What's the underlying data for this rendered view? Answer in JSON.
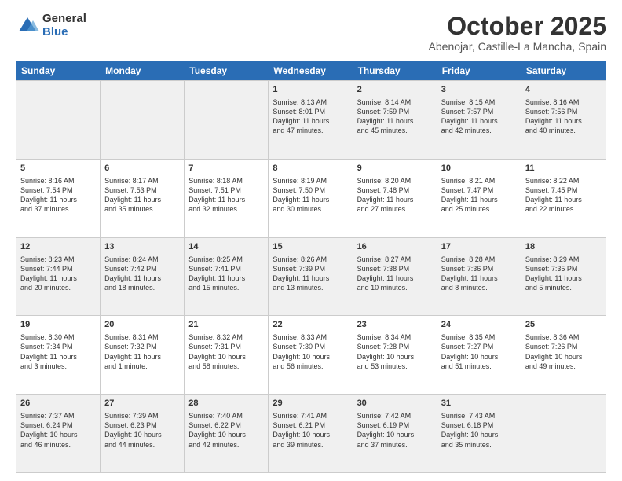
{
  "logo": {
    "general": "General",
    "blue": "Blue"
  },
  "header": {
    "month": "October 2025",
    "location": "Abenojar, Castille-La Mancha, Spain"
  },
  "days": [
    "Sunday",
    "Monday",
    "Tuesday",
    "Wednesday",
    "Thursday",
    "Friday",
    "Saturday"
  ],
  "rows": [
    [
      {
        "num": "",
        "text": ""
      },
      {
        "num": "",
        "text": ""
      },
      {
        "num": "",
        "text": ""
      },
      {
        "num": "1",
        "text": "Sunrise: 8:13 AM\nSunset: 8:01 PM\nDaylight: 11 hours\nand 47 minutes."
      },
      {
        "num": "2",
        "text": "Sunrise: 8:14 AM\nSunset: 7:59 PM\nDaylight: 11 hours\nand 45 minutes."
      },
      {
        "num": "3",
        "text": "Sunrise: 8:15 AM\nSunset: 7:57 PM\nDaylight: 11 hours\nand 42 minutes."
      },
      {
        "num": "4",
        "text": "Sunrise: 8:16 AM\nSunset: 7:56 PM\nDaylight: 11 hours\nand 40 minutes."
      }
    ],
    [
      {
        "num": "5",
        "text": "Sunrise: 8:16 AM\nSunset: 7:54 PM\nDaylight: 11 hours\nand 37 minutes."
      },
      {
        "num": "6",
        "text": "Sunrise: 8:17 AM\nSunset: 7:53 PM\nDaylight: 11 hours\nand 35 minutes."
      },
      {
        "num": "7",
        "text": "Sunrise: 8:18 AM\nSunset: 7:51 PM\nDaylight: 11 hours\nand 32 minutes."
      },
      {
        "num": "8",
        "text": "Sunrise: 8:19 AM\nSunset: 7:50 PM\nDaylight: 11 hours\nand 30 minutes."
      },
      {
        "num": "9",
        "text": "Sunrise: 8:20 AM\nSunset: 7:48 PM\nDaylight: 11 hours\nand 27 minutes."
      },
      {
        "num": "10",
        "text": "Sunrise: 8:21 AM\nSunset: 7:47 PM\nDaylight: 11 hours\nand 25 minutes."
      },
      {
        "num": "11",
        "text": "Sunrise: 8:22 AM\nSunset: 7:45 PM\nDaylight: 11 hours\nand 22 minutes."
      }
    ],
    [
      {
        "num": "12",
        "text": "Sunrise: 8:23 AM\nSunset: 7:44 PM\nDaylight: 11 hours\nand 20 minutes."
      },
      {
        "num": "13",
        "text": "Sunrise: 8:24 AM\nSunset: 7:42 PM\nDaylight: 11 hours\nand 18 minutes."
      },
      {
        "num": "14",
        "text": "Sunrise: 8:25 AM\nSunset: 7:41 PM\nDaylight: 11 hours\nand 15 minutes."
      },
      {
        "num": "15",
        "text": "Sunrise: 8:26 AM\nSunset: 7:39 PM\nDaylight: 11 hours\nand 13 minutes."
      },
      {
        "num": "16",
        "text": "Sunrise: 8:27 AM\nSunset: 7:38 PM\nDaylight: 11 hours\nand 10 minutes."
      },
      {
        "num": "17",
        "text": "Sunrise: 8:28 AM\nSunset: 7:36 PM\nDaylight: 11 hours\nand 8 minutes."
      },
      {
        "num": "18",
        "text": "Sunrise: 8:29 AM\nSunset: 7:35 PM\nDaylight: 11 hours\nand 5 minutes."
      }
    ],
    [
      {
        "num": "19",
        "text": "Sunrise: 8:30 AM\nSunset: 7:34 PM\nDaylight: 11 hours\nand 3 minutes."
      },
      {
        "num": "20",
        "text": "Sunrise: 8:31 AM\nSunset: 7:32 PM\nDaylight: 11 hours\nand 1 minute."
      },
      {
        "num": "21",
        "text": "Sunrise: 8:32 AM\nSunset: 7:31 PM\nDaylight: 10 hours\nand 58 minutes."
      },
      {
        "num": "22",
        "text": "Sunrise: 8:33 AM\nSunset: 7:30 PM\nDaylight: 10 hours\nand 56 minutes."
      },
      {
        "num": "23",
        "text": "Sunrise: 8:34 AM\nSunset: 7:28 PM\nDaylight: 10 hours\nand 53 minutes."
      },
      {
        "num": "24",
        "text": "Sunrise: 8:35 AM\nSunset: 7:27 PM\nDaylight: 10 hours\nand 51 minutes."
      },
      {
        "num": "25",
        "text": "Sunrise: 8:36 AM\nSunset: 7:26 PM\nDaylight: 10 hours\nand 49 minutes."
      }
    ],
    [
      {
        "num": "26",
        "text": "Sunrise: 7:37 AM\nSunset: 6:24 PM\nDaylight: 10 hours\nand 46 minutes."
      },
      {
        "num": "27",
        "text": "Sunrise: 7:39 AM\nSunset: 6:23 PM\nDaylight: 10 hours\nand 44 minutes."
      },
      {
        "num": "28",
        "text": "Sunrise: 7:40 AM\nSunset: 6:22 PM\nDaylight: 10 hours\nand 42 minutes."
      },
      {
        "num": "29",
        "text": "Sunrise: 7:41 AM\nSunset: 6:21 PM\nDaylight: 10 hours\nand 39 minutes."
      },
      {
        "num": "30",
        "text": "Sunrise: 7:42 AM\nSunset: 6:19 PM\nDaylight: 10 hours\nand 37 minutes."
      },
      {
        "num": "31",
        "text": "Sunrise: 7:43 AM\nSunset: 6:18 PM\nDaylight: 10 hours\nand 35 minutes."
      },
      {
        "num": "",
        "text": ""
      }
    ]
  ],
  "shaded_rows": [
    0,
    2,
    4
  ]
}
